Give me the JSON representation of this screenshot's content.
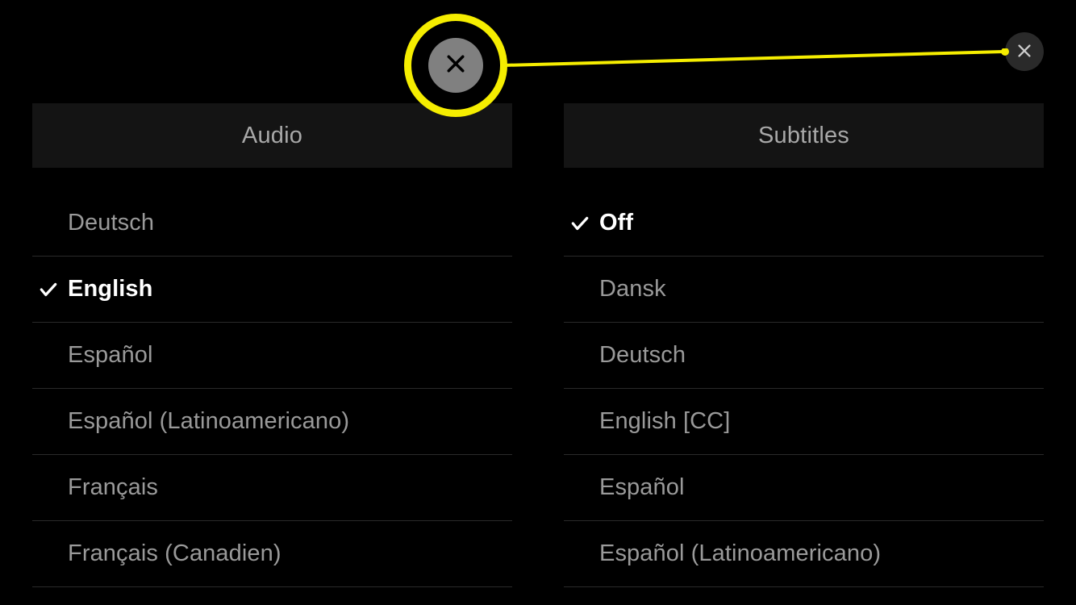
{
  "audio": {
    "header": "Audio",
    "items": [
      {
        "label": "Deutsch",
        "selected": false
      },
      {
        "label": "English",
        "selected": true
      },
      {
        "label": "Español",
        "selected": false
      },
      {
        "label": "Español (Latinoamericano)",
        "selected": false
      },
      {
        "label": "Français",
        "selected": false
      },
      {
        "label": "Français (Canadien)",
        "selected": false
      }
    ]
  },
  "subtitles": {
    "header": "Subtitles",
    "items": [
      {
        "label": "Off",
        "selected": true
      },
      {
        "label": "Dansk",
        "selected": false
      },
      {
        "label": "Deutsch",
        "selected": false
      },
      {
        "label": "English [CC]",
        "selected": false
      },
      {
        "label": "Español",
        "selected": false
      },
      {
        "label": "Español (Latinoamericano)",
        "selected": false
      }
    ]
  },
  "colors": {
    "callout": "#f5ed00"
  }
}
